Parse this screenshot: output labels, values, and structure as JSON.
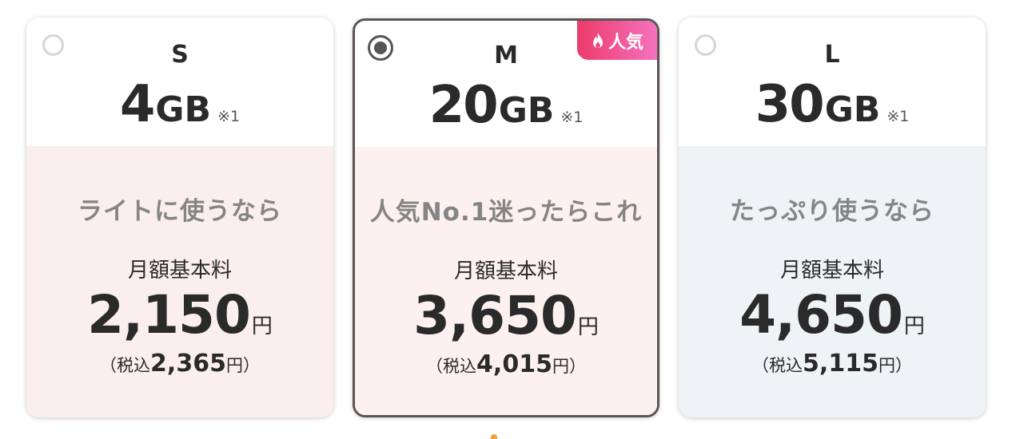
{
  "plans": [
    {
      "size": "S",
      "data_num": "4",
      "data_unit": "GB",
      "note": "※1",
      "tagline": "ライトに使うなら",
      "fee_label": "月額基本料",
      "price": "2,150",
      "yen": "円",
      "tax_open": "（税込",
      "tax_price": "2,365",
      "tax_close": "円）",
      "bg_color": "#fbeeee",
      "selected": false
    },
    {
      "size": "M",
      "data_num": "20",
      "data_unit": "GB",
      "note": "※1",
      "tagline": "人気No.1迷ったらこれ",
      "fee_label": "月額基本料",
      "price": "3,650",
      "yen": "円",
      "tax_open": "（税込",
      "tax_price": "4,015",
      "tax_close": "円）",
      "bg_color": "#fdf1ef",
      "selected": true,
      "badge": {
        "icon": "flame-icon",
        "label": "人気"
      }
    },
    {
      "size": "L",
      "data_num": "30",
      "data_unit": "GB",
      "note": "※1",
      "tagline": "たっぷり使うなら",
      "fee_label": "月額基本料",
      "price": "4,650",
      "yen": "円",
      "tax_open": "（税込",
      "tax_price": "5,115",
      "tax_close": "円）",
      "bg_color": "#eef3f5",
      "selected": false
    }
  ],
  "colors": {
    "badge_start": "#ec3b6a",
    "badge_end": "#f472be",
    "selected_border": "#5b5453",
    "tagline_text": "#858585"
  }
}
